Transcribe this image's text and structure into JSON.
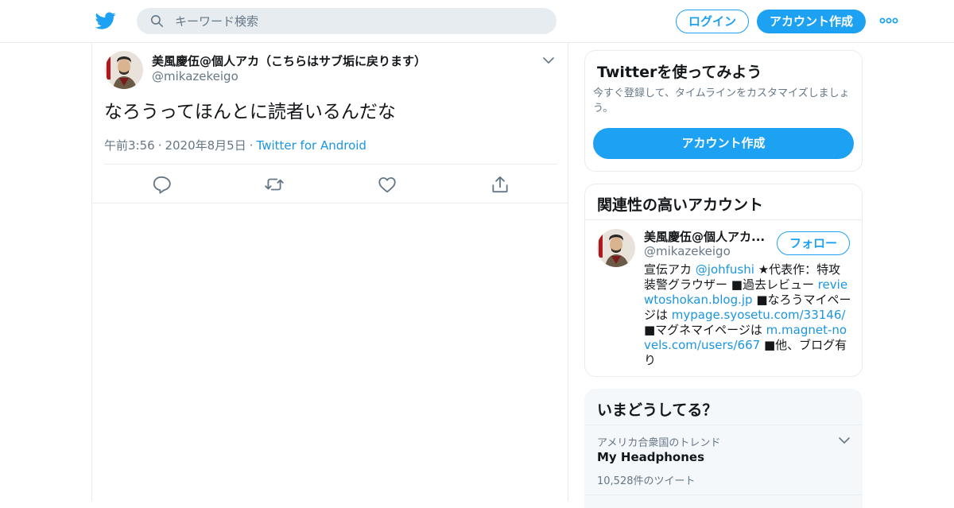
{
  "header": {
    "search_placeholder": "キーワード検索",
    "login_label": "ログイン",
    "signup_label": "アカウント作成"
  },
  "tweet": {
    "author_name": "美風慶伍@個人アカ（こちらはサブ垢に戻ります）",
    "author_handle": "@mikazekeigo",
    "text": "なろうってほんとに読者いるんだな",
    "time": "午前3:56",
    "date": "2020年8月5日",
    "source": "Twitter for Android",
    "meta_separator": "·"
  },
  "signup_card": {
    "title": "Twitterを使ってみよう",
    "description": "今すぐ登録して、タイムラインをカスタマイズしましょう。",
    "button_label": "アカウント作成"
  },
  "related": {
    "title": "関連性の高いアカウント",
    "name": "美風慶伍@個人アカ...",
    "handle": "@mikazekeigo",
    "follow_label": "フォロー",
    "bio": {
      "p1": "宣伝アカ ",
      "link1": "@johfushi",
      "p2": " ★代表作：特攻装警グラウザー ■過去レビュー ",
      "link2": "reviewtoshokan.blog.jp",
      "p3": " ■なろうマイページは ",
      "link3": "mypage.syosetu.com/33146/",
      "p4": " ■マグネマイページは ",
      "link4": "m.magnet-novels.com/users/667",
      "p5": " ■他、ブログ有り"
    }
  },
  "trends": {
    "title": "いまどうしてる？",
    "items": [
      {
        "context": "アメリカ合衆国のトレンド",
        "name": "My Headphones",
        "count": "10,528件のツイート"
      }
    ]
  },
  "colors": {
    "accent": "#1da1f2",
    "link": "#1b95e0",
    "secondary_text": "#657786",
    "border": "#e6ecf0"
  },
  "icons": {
    "logo": "twitter-bird-icon",
    "search": "search-icon",
    "more": "more-dots-icon",
    "caret": "chevron-down-icon",
    "reply": "reply-icon",
    "retweet": "retweet-icon",
    "like": "heart-icon",
    "share": "share-icon"
  }
}
